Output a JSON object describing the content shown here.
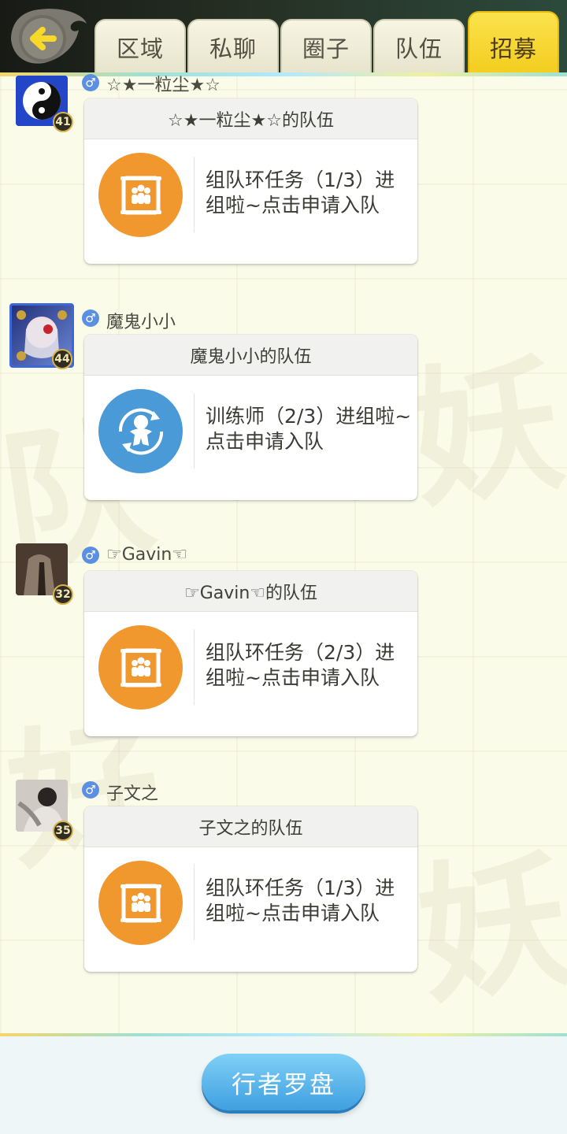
{
  "header": {
    "back_icon": "back-arrow-icon",
    "tabs": [
      {
        "label": "区域"
      },
      {
        "label": "私聊"
      },
      {
        "label": "圈子"
      },
      {
        "label": "队伍"
      },
      {
        "label": "招募",
        "active": true
      }
    ]
  },
  "posts": [
    {
      "username": "☆★一粒尘★☆",
      "gender": "♂",
      "level": "41",
      "card_title": "☆★一粒尘★☆的队伍",
      "icon": "team-scroll-icon",
      "icon_color": "#f0972e",
      "message": "组队环任务（1/3）进组啦~点击申请入队"
    },
    {
      "username": "魔鬼小小",
      "gender": "♂",
      "level": "44",
      "card_title": "魔鬼小小的队伍",
      "icon": "trainer-cycle-icon",
      "icon_color": "#4a9ad8",
      "message": "训练师（2/3）进组啦~点击申请入队"
    },
    {
      "username": "☞Gavin☜",
      "gender": "♂",
      "level": "32",
      "card_title": "☞Gavin☜的队伍",
      "icon": "team-scroll-icon",
      "icon_color": "#f0972e",
      "message": "组队环任务（2/3）进组啦~点击申请入队"
    },
    {
      "username": "子文之",
      "gender": "♂",
      "level": "35",
      "card_title": "子文之的队伍",
      "icon": "team-scroll-icon",
      "icon_color": "#f0972e",
      "message": "组队环任务（1/3）进组啦~点击申请入队"
    }
  ],
  "footer": {
    "compass_label": "行者罗盘"
  },
  "colors": {
    "accent_yellow": "#f3cd1f",
    "orange_icon": "#f0972e",
    "blue_icon": "#4a9ad8",
    "button_blue": "#3f9fe0"
  }
}
